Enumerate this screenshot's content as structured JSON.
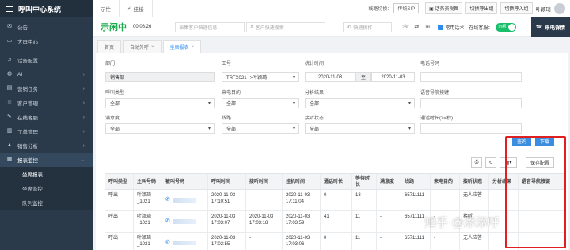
{
  "app": {
    "title": "呼叫中心系统"
  },
  "sidebar": {
    "items": [
      {
        "label": "公告",
        "icon": "announcement-icon",
        "has_arrow": false
      },
      {
        "label": "大屏中心",
        "icon": "screen-icon",
        "has_arrow": false
      },
      {
        "label": "话务配置",
        "icon": "headset-icon",
        "has_arrow": false
      },
      {
        "label": "AI",
        "icon": "robot-icon",
        "has_arrow": true
      },
      {
        "label": "营销任务",
        "icon": "task-icon",
        "has_arrow": true
      },
      {
        "label": "客户管理",
        "icon": "customer-icon",
        "has_arrow": true
      },
      {
        "label": "在线客服",
        "icon": "chat-icon",
        "has_arrow": true
      },
      {
        "label": "工单管理",
        "icon": "ticket-icon",
        "has_arrow": true
      },
      {
        "label": "销售分析",
        "icon": "chart-icon",
        "has_arrow": true
      },
      {
        "label": "报表监控",
        "icon": "report-icon",
        "has_arrow": true
      }
    ],
    "subitems": [
      "坐席报表",
      "坐席监控",
      "队列监控"
    ]
  },
  "topbar": {
    "tabs": [
      "示忙",
      "挂接"
    ],
    "line_switch_label": "线路切换：",
    "line_switch_value": "传统SIP",
    "agent_view": "话务员视图",
    "btn_switch_out": "切换呼出组",
    "btn_switch_in": "切换呼入组",
    "user_name": "叶颖琦"
  },
  "statusbar": {
    "status": "示闲中",
    "timer": "00:08:26",
    "collect_placeholder": "采集客户快速信息",
    "quick_search_placeholder": "客户快速搜索",
    "phone_placeholder": "快速拨打",
    "common_words": "常用话术",
    "online_service": "在线客服：",
    "toggle_label": "示闲",
    "incoming_detail": "来电详情"
  },
  "pagetabs": [
    {
      "label": "首页",
      "closable": false
    },
    {
      "label": "自动外呼",
      "closable": true
    },
    {
      "label": "坐席报表",
      "closable": true
    }
  ],
  "filters": {
    "dept_label": "部门",
    "dept_value": "销售部",
    "agent_label": "工号",
    "agent_value": "TRTX021-->叶颖琦",
    "time_label": "统计时间",
    "time_from": "2020-11-03",
    "time_to_label": "至",
    "time_to": "2020-11-03",
    "phone_label": "电话号码",
    "calltype_label": "呼叫类型",
    "calltype_value": "全部",
    "purpose_label": "来电目的",
    "purpose_value": "全部",
    "result_label": "分析结果",
    "result_value": "全部",
    "ivr_label": "语音导航按键",
    "satisfaction_label": "满意度",
    "satisfaction_value": "全部",
    "line_label": "线路",
    "line_value": "全部",
    "answer_label": "接听状态",
    "answer_value": "全部",
    "duration_label": "通话时长(>=秒)",
    "query_button": "查询",
    "download_button": "下载",
    "save_config_button": "保存配置"
  },
  "table": {
    "columns": [
      "呼叫类型",
      "主叫号码",
      "被叫号码",
      "呼叫时间",
      "接听时间",
      "挂机时间",
      "通话时长",
      "等待时长",
      "满意度",
      "线路",
      "来电目的",
      "接听状态",
      "分析结果",
      "语音导航按键"
    ],
    "rows": [
      [
        "呼出",
        "叶颖琦_1021",
        "",
        "2020-11-03 17:10:51",
        "-",
        "2020-11-03 17:11:04",
        "0",
        "13",
        "-",
        "65711111",
        "-",
        "无人应答",
        "",
        ""
      ],
      [
        "呼出",
        "叶颖琦_1021",
        "",
        "2020-11-03 17:03:07",
        "2020-11-03 17:03:18",
        "2020-11-03 17:03:59",
        "41",
        "11",
        "-",
        "65711111",
        "-",
        "接听",
        "",
        ""
      ],
      [
        "呼出",
        "叶颖琦_1021",
        "",
        "2020-11-03 17:02:55",
        "-",
        "2020-11-03 17:03:06",
        "0",
        "11",
        "-",
        "65711111",
        "-",
        "无人应答",
        "",
        ""
      ]
    ]
  },
  "watermark": "知乎 @添添呼",
  "colors": {
    "sidebar_bg": "#2b3a4a",
    "status_green": "#19a94b",
    "primary_blue": "#3b8de0",
    "highlight_red": "#e02020"
  }
}
